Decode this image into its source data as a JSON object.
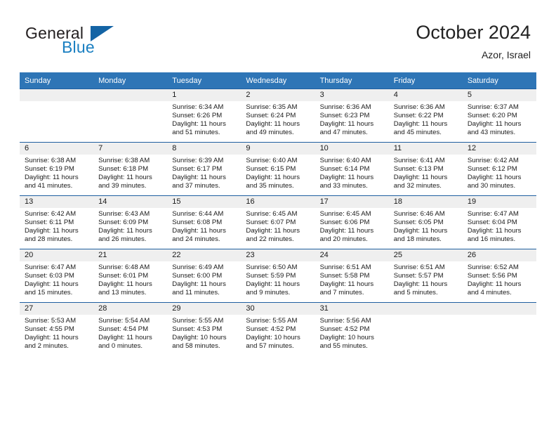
{
  "brand": {
    "name_part1": "General",
    "name_part2": "Blue",
    "triangle_color": "#1464a5",
    "blue_text_color": "#1a7fc1"
  },
  "header": {
    "title": "October 2024",
    "subtitle": "Azor, Israel"
  },
  "theme": {
    "header_row_bg": "#2e75b6",
    "row_divider": "#1f5fa0",
    "daynum_band_bg": "#efefef"
  },
  "calendar": {
    "weekday_headers": [
      "Sunday",
      "Monday",
      "Tuesday",
      "Wednesday",
      "Thursday",
      "Friday",
      "Saturday"
    ],
    "weeks": [
      [
        {
          "day": "",
          "lines": []
        },
        {
          "day": "",
          "lines": []
        },
        {
          "day": "1",
          "lines": [
            "Sunrise: 6:34 AM",
            "Sunset: 6:26 PM",
            "Daylight: 11 hours",
            "and 51 minutes."
          ]
        },
        {
          "day": "2",
          "lines": [
            "Sunrise: 6:35 AM",
            "Sunset: 6:24 PM",
            "Daylight: 11 hours",
            "and 49 minutes."
          ]
        },
        {
          "day": "3",
          "lines": [
            "Sunrise: 6:36 AM",
            "Sunset: 6:23 PM",
            "Daylight: 11 hours",
            "and 47 minutes."
          ]
        },
        {
          "day": "4",
          "lines": [
            "Sunrise: 6:36 AM",
            "Sunset: 6:22 PM",
            "Daylight: 11 hours",
            "and 45 minutes."
          ]
        },
        {
          "day": "5",
          "lines": [
            "Sunrise: 6:37 AM",
            "Sunset: 6:20 PM",
            "Daylight: 11 hours",
            "and 43 minutes."
          ]
        }
      ],
      [
        {
          "day": "6",
          "lines": [
            "Sunrise: 6:38 AM",
            "Sunset: 6:19 PM",
            "Daylight: 11 hours",
            "and 41 minutes."
          ]
        },
        {
          "day": "7",
          "lines": [
            "Sunrise: 6:38 AM",
            "Sunset: 6:18 PM",
            "Daylight: 11 hours",
            "and 39 minutes."
          ]
        },
        {
          "day": "8",
          "lines": [
            "Sunrise: 6:39 AM",
            "Sunset: 6:17 PM",
            "Daylight: 11 hours",
            "and 37 minutes."
          ]
        },
        {
          "day": "9",
          "lines": [
            "Sunrise: 6:40 AM",
            "Sunset: 6:15 PM",
            "Daylight: 11 hours",
            "and 35 minutes."
          ]
        },
        {
          "day": "10",
          "lines": [
            "Sunrise: 6:40 AM",
            "Sunset: 6:14 PM",
            "Daylight: 11 hours",
            "and 33 minutes."
          ]
        },
        {
          "day": "11",
          "lines": [
            "Sunrise: 6:41 AM",
            "Sunset: 6:13 PM",
            "Daylight: 11 hours",
            "and 32 minutes."
          ]
        },
        {
          "day": "12",
          "lines": [
            "Sunrise: 6:42 AM",
            "Sunset: 6:12 PM",
            "Daylight: 11 hours",
            "and 30 minutes."
          ]
        }
      ],
      [
        {
          "day": "13",
          "lines": [
            "Sunrise: 6:42 AM",
            "Sunset: 6:11 PM",
            "Daylight: 11 hours",
            "and 28 minutes."
          ]
        },
        {
          "day": "14",
          "lines": [
            "Sunrise: 6:43 AM",
            "Sunset: 6:09 PM",
            "Daylight: 11 hours",
            "and 26 minutes."
          ]
        },
        {
          "day": "15",
          "lines": [
            "Sunrise: 6:44 AM",
            "Sunset: 6:08 PM",
            "Daylight: 11 hours",
            "and 24 minutes."
          ]
        },
        {
          "day": "16",
          "lines": [
            "Sunrise: 6:45 AM",
            "Sunset: 6:07 PM",
            "Daylight: 11 hours",
            "and 22 minutes."
          ]
        },
        {
          "day": "17",
          "lines": [
            "Sunrise: 6:45 AM",
            "Sunset: 6:06 PM",
            "Daylight: 11 hours",
            "and 20 minutes."
          ]
        },
        {
          "day": "18",
          "lines": [
            "Sunrise: 6:46 AM",
            "Sunset: 6:05 PM",
            "Daylight: 11 hours",
            "and 18 minutes."
          ]
        },
        {
          "day": "19",
          "lines": [
            "Sunrise: 6:47 AM",
            "Sunset: 6:04 PM",
            "Daylight: 11 hours",
            "and 16 minutes."
          ]
        }
      ],
      [
        {
          "day": "20",
          "lines": [
            "Sunrise: 6:47 AM",
            "Sunset: 6:03 PM",
            "Daylight: 11 hours",
            "and 15 minutes."
          ]
        },
        {
          "day": "21",
          "lines": [
            "Sunrise: 6:48 AM",
            "Sunset: 6:01 PM",
            "Daylight: 11 hours",
            "and 13 minutes."
          ]
        },
        {
          "day": "22",
          "lines": [
            "Sunrise: 6:49 AM",
            "Sunset: 6:00 PM",
            "Daylight: 11 hours",
            "and 11 minutes."
          ]
        },
        {
          "day": "23",
          "lines": [
            "Sunrise: 6:50 AM",
            "Sunset: 5:59 PM",
            "Daylight: 11 hours",
            "and 9 minutes."
          ]
        },
        {
          "day": "24",
          "lines": [
            "Sunrise: 6:51 AM",
            "Sunset: 5:58 PM",
            "Daylight: 11 hours",
            "and 7 minutes."
          ]
        },
        {
          "day": "25",
          "lines": [
            "Sunrise: 6:51 AM",
            "Sunset: 5:57 PM",
            "Daylight: 11 hours",
            "and 5 minutes."
          ]
        },
        {
          "day": "26",
          "lines": [
            "Sunrise: 6:52 AM",
            "Sunset: 5:56 PM",
            "Daylight: 11 hours",
            "and 4 minutes."
          ]
        }
      ],
      [
        {
          "day": "27",
          "lines": [
            "Sunrise: 5:53 AM",
            "Sunset: 4:55 PM",
            "Daylight: 11 hours",
            "and 2 minutes."
          ]
        },
        {
          "day": "28",
          "lines": [
            "Sunrise: 5:54 AM",
            "Sunset: 4:54 PM",
            "Daylight: 11 hours",
            "and 0 minutes."
          ]
        },
        {
          "day": "29",
          "lines": [
            "Sunrise: 5:55 AM",
            "Sunset: 4:53 PM",
            "Daylight: 10 hours",
            "and 58 minutes."
          ]
        },
        {
          "day": "30",
          "lines": [
            "Sunrise: 5:55 AM",
            "Sunset: 4:52 PM",
            "Daylight: 10 hours",
            "and 57 minutes."
          ]
        },
        {
          "day": "31",
          "lines": [
            "Sunrise: 5:56 AM",
            "Sunset: 4:52 PM",
            "Daylight: 10 hours",
            "and 55 minutes."
          ]
        },
        {
          "day": "",
          "lines": []
        },
        {
          "day": "",
          "lines": []
        }
      ]
    ]
  }
}
